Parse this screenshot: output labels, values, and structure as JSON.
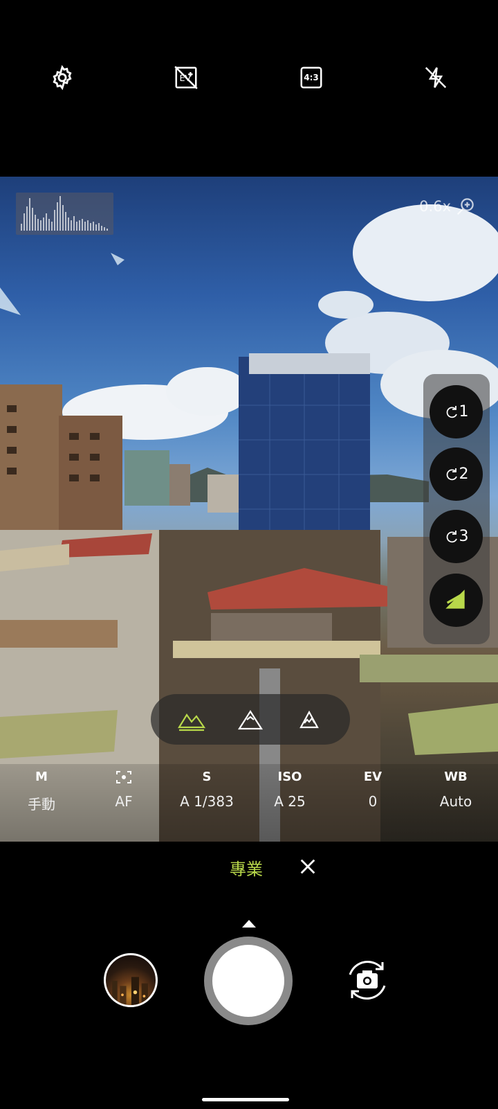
{
  "top_bar": {
    "icons": [
      "gear-icon",
      "exposure-compensation-off-icon",
      "aspect-ratio-icon",
      "flash-off-icon"
    ],
    "aspect_ratio_label": "4:3"
  },
  "viewfinder": {
    "zoom_label": "0.6x",
    "custom_buttons": [
      {
        "label": "1"
      },
      {
        "label": "2"
      },
      {
        "label": "3"
      }
    ],
    "scene_modes_count": 3
  },
  "pro_params": [
    {
      "key": "M",
      "value": "手動"
    },
    {
      "key": "",
      "value": "AF"
    },
    {
      "key": "S",
      "value": "A 1/383"
    },
    {
      "key": "ISO",
      "value": "A 25"
    },
    {
      "key": "EV",
      "value": "0"
    },
    {
      "key": "WB",
      "value": "Auto"
    }
  ],
  "mode": {
    "label": "專業"
  },
  "colors": {
    "accent": "#b8d84a",
    "background": "#000000",
    "panel": "#111111"
  }
}
